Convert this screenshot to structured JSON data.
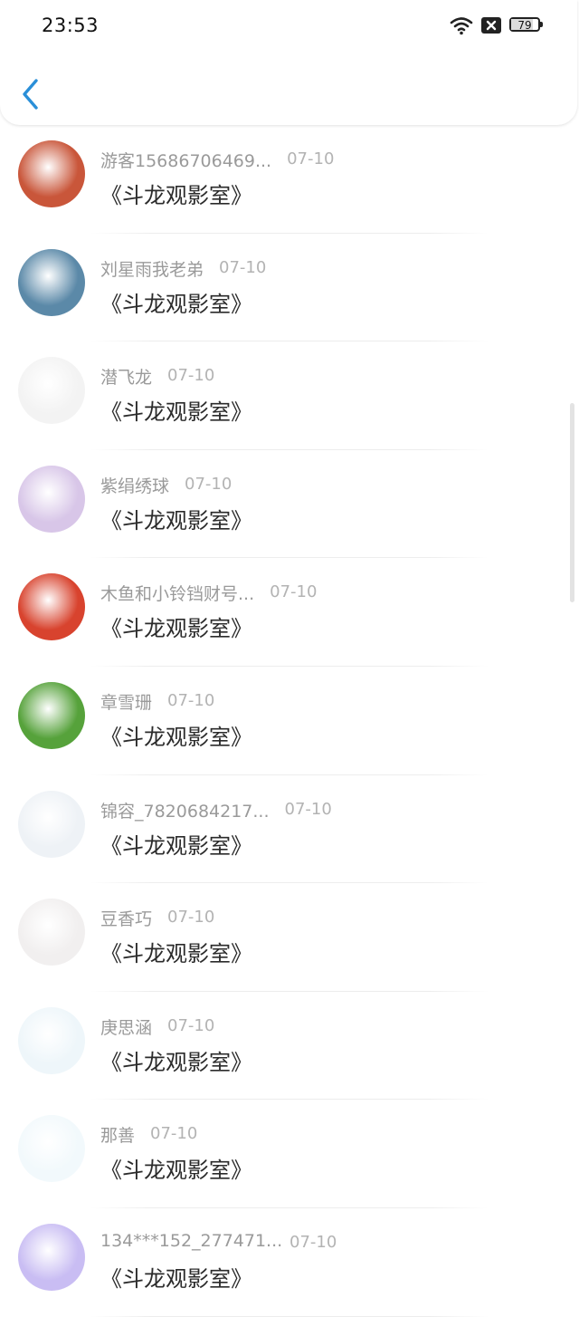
{
  "status_bar": {
    "time": "23:53",
    "battery": "79",
    "battery_level": 0.79
  },
  "items": [
    {
      "name": "游客15686706469...",
      "date": "07-10",
      "title": "《斗龙观影室》",
      "avatar_color": "#c9563a"
    },
    {
      "name": "刘星雨我老弟",
      "date": "07-10",
      "title": "《斗龙观影室》",
      "avatar_color": "#5b89a8"
    },
    {
      "name": "潜飞龙",
      "date": "07-10",
      "title": "《斗龙观影室》",
      "avatar_color": "#f3f3f3"
    },
    {
      "name": "紫绢绣球",
      "date": "07-10",
      "title": "《斗龙观影室》",
      "avatar_color": "#d8c6e8"
    },
    {
      "name": "木鱼和小铃铛财号...",
      "date": "07-10",
      "title": "《斗龙观影室》",
      "avatar_color": "#d8432e"
    },
    {
      "name": "章雪珊",
      "date": "07-10",
      "title": "《斗龙观影室》",
      "avatar_color": "#56a23b"
    },
    {
      "name": "锦容_7820684217...",
      "date": "07-10",
      "title": "《斗龙观影室》",
      "avatar_color": "#eef2f6"
    },
    {
      "name": "豆香巧",
      "date": "07-10",
      "title": "《斗龙观影室》",
      "avatar_color": "#f1efef"
    },
    {
      "name": "庚思涵",
      "date": "07-10",
      "title": "《斗龙观影室》",
      "avatar_color": "#eef6fa"
    },
    {
      "name": "那善",
      "date": "07-10",
      "title": "《斗龙观影室》",
      "avatar_color": "#f2f9fc"
    },
    {
      "name": "134***152_277471...",
      "date": "07-10",
      "title": "《斗龙观影室》",
      "avatar_color": "#c9bdf3"
    }
  ]
}
